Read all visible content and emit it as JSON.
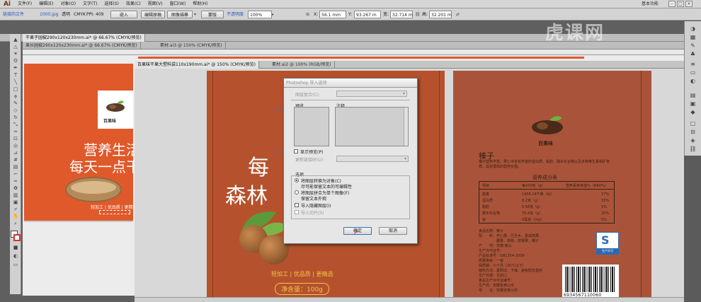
{
  "app": {
    "logo": "Ai",
    "menus": [
      "文件(F)",
      "编辑(E)",
      "对象(O)",
      "文字(T)",
      "选择(S)",
      "效果(C)",
      "视图(V)",
      "窗口(W)",
      "帮助(H)"
    ],
    "workspace": "基本功能"
  },
  "control": {
    "linked_file": "链接的文件",
    "filename": "1000.jpg",
    "transparent": "透明",
    "color_mode": "CMYK",
    "ppi_label": "PPI:",
    "ppi": "409",
    "embed": "嵌入",
    "edit_original": "编辑原稿",
    "image_trace": "图像描摹",
    "mask": "蒙版",
    "opacity_label": "不透明度",
    "opacity": "100%",
    "x": "56.1 mm",
    "y": "93.267 m",
    "w": "32.714 m",
    "h": "32.201 m"
  },
  "tabs": {
    "back1": "干果子园椒290x120x230mm.ai* @ 66.67% (CMYK/预览)",
    "back2a": "果长园椒290x120x230mm.ai* @ 66.67% (CMYK/预览)",
    "back2b": "素材.ai3 @ 150% (CMYK/预览)",
    "front1": "百果味干果大塑料袋110x190mm.ai* @ 150% (CMYK/预览)",
    "front2": "素材.ai2 @ 100% (RGB/预览)"
  },
  "left_art": {
    "brand": "百果味",
    "slogan1": "营养生活",
    "slogan2": "每天一点干",
    "tags": "轻加工 | 优品质 | 更精选"
  },
  "center_art": {
    "line1": "每",
    "line2": "森林",
    "tags": "轻加工 | 优品质 | 更精选",
    "net": "净含量：100g"
  },
  "right_art": {
    "brand": "百果味",
    "product": "榛子",
    "desc": "榛子营养丰富，果仁中含有丰富的蛋白质、脂肪、碳水化合物以及多种维生素和矿物质，具有很高的营养价值。",
    "nutrition_title": "营养成分表",
    "nutrition_header": [
      "项目",
      "每100克（g）",
      "营养素参考值%（NRV%）"
    ],
    "nutrition_rows": [
      [
        "能量",
        "1458.16千焦（kJ）",
        "17%"
      ],
      [
        "蛋白质",
        "8.2克（g）",
        "15%"
      ],
      [
        "脂肪",
        "0.56克（g）",
        "1%"
      ],
      [
        "碳水化合物",
        "75.4克（g）",
        "25%"
      ],
      [
        "钠",
        "0毫克（mg）",
        "0%"
      ]
    ],
    "ingredients": [
      "食品名称：榛子",
      "配　　料：开心果、巴旦木、夏威夷果、",
      "　　　　　腰果、核桃、碧根果、榛子",
      "产　　地：安徽·黄山",
      "生产许可证号：",
      "产品标准号：GB1354-2009",
      "质量等级：一级",
      "保质期：六个月（20℃以下）",
      "储存方法：置阴凉、干燥、避免阳光直射",
      "生产日期：见封口",
      "食品生产许可证编号：",
      "生产商：安徽省黄山市",
      "地　　址：安徽省黄山市"
    ],
    "qs": "生产许可",
    "barcode": "6934567110060"
  },
  "dialog": {
    "title": "Photoshop 导入选项",
    "comp_label": "图层复合(C):",
    "preview_label": "预览",
    "comment_label": "注释",
    "show_preview": "显示预览(P)",
    "update_label": "更新链接时(U):",
    "options_label": "选项",
    "opt1a": "将图层转换为对象(C)",
    "opt1b": "尽可能保留文本的可编辑性",
    "opt2a": "将图层拼合为单个图像(F)",
    "opt2b": "保留文本外观",
    "opt3": "导入隐藏图层(I)",
    "opt4": "导入切片(S)",
    "ok": "确定",
    "cancel": "取消"
  },
  "watermark": "虎课网"
}
